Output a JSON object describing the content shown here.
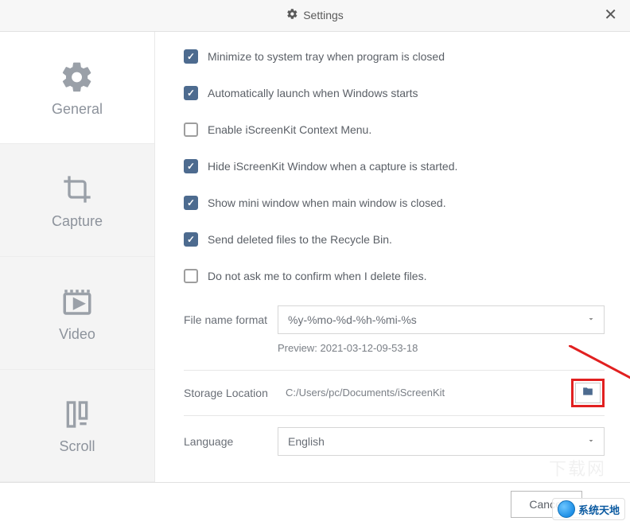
{
  "title": "Settings",
  "sidebar": {
    "items": [
      {
        "id": "general",
        "label": "General",
        "active": true
      },
      {
        "id": "capture",
        "label": "Capture",
        "active": false
      },
      {
        "id": "video",
        "label": "Video",
        "active": false
      },
      {
        "id": "scroll",
        "label": "Scroll",
        "active": false
      }
    ]
  },
  "options": [
    {
      "id": "minimize_tray",
      "checked": true,
      "label": "Minimize to system tray when program is closed"
    },
    {
      "id": "auto_launch",
      "checked": true,
      "label": "Automatically launch when Windows starts"
    },
    {
      "id": "context_menu",
      "checked": false,
      "label": "Enable iScreenKit Context Menu."
    },
    {
      "id": "hide_on_capture",
      "checked": true,
      "label": "Hide iScreenKit Window when a capture is started."
    },
    {
      "id": "show_mini",
      "checked": true,
      "label": "Show mini window when main window is closed."
    },
    {
      "id": "recycle_bin",
      "checked": true,
      "label": "Send deleted files to the Recycle Bin."
    },
    {
      "id": "confirm_delete",
      "checked": false,
      "label": "Do not ask me to confirm when I delete files."
    }
  ],
  "filename": {
    "label": "File name format",
    "value": "%y-%mo-%d-%h-%mi-%s",
    "preview_label": "Preview:",
    "preview_value": "2021-03-12-09-53-18"
  },
  "storage": {
    "label": "Storage Location",
    "path": "C:/Users/pc/Documents/iScreenKit"
  },
  "language": {
    "label": "Language",
    "value": "English"
  },
  "footer": {
    "cancel": "Cancel"
  },
  "watermark": "系统天地"
}
